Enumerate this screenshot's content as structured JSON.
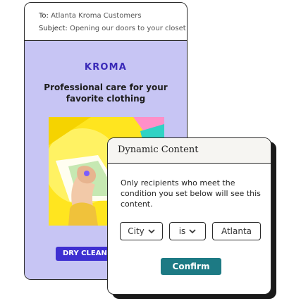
{
  "email": {
    "to_label": "To:",
    "to_value": "Atlanta Kroma Customers",
    "subject_label": "Subject:",
    "subject_value": "Opening our doors to your closet",
    "brand": "KROMA",
    "headline_line1": "Professional care for your",
    "headline_line2": "favorite clothing",
    "hero_image": "person-holding-clothing-hanger-illustration",
    "cta_label": "DRY CLEAN Y"
  },
  "dialog": {
    "title": "Dynamic Content",
    "description": "Only recipients who meet the condition you set below will see this content.",
    "condition": {
      "field": "City",
      "operator": "is",
      "value": "Atlanta"
    },
    "confirm_label": "Confirm"
  },
  "colors": {
    "email_body_bg": "#c7c5f4",
    "brand": "#3a2ab8",
    "cta": "#3e2fd1",
    "confirm": "#1d7a84",
    "hero_yellow": "#ffe51f"
  }
}
